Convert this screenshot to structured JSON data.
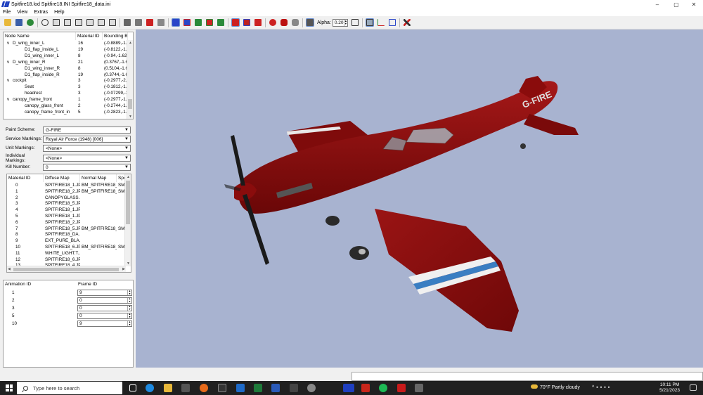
{
  "window": {
    "title": "Spitfire18.lod  Spitfire18.INI  Spitfire18_data.ini",
    "controls": [
      "–",
      "▢",
      "✕"
    ]
  },
  "menu": [
    "File",
    "View",
    "Extras",
    "Help"
  ],
  "toolbar": {
    "alpha_label": "Alpha:",
    "alpha_value": "0.20"
  },
  "node_tree": {
    "headers": [
      "Node Name",
      "Material ID",
      "Bounding Bo"
    ],
    "rows": [
      {
        "indent": 1,
        "expander": "v",
        "name": "D_wing_inner_L",
        "mat": "16",
        "bb": "(-0.8889,-1.6"
      },
      {
        "indent": 2,
        "expander": "",
        "name": "D1_flap_inside_L",
        "mat": "19",
        "bb": "(-0.8122,-1.6"
      },
      {
        "indent": 2,
        "expander": "",
        "name": "D1_wing_inner_L",
        "mat": "8",
        "bb": "(-0.94,-1.62,-"
      },
      {
        "indent": 1,
        "expander": "v",
        "name": "D_wing_inner_R",
        "mat": "21",
        "bb": "(0.3767,-1.62"
      },
      {
        "indent": 2,
        "expander": "",
        "name": "D1_wing_inner_R",
        "mat": "8",
        "bb": "(0.5104,-1.62"
      },
      {
        "indent": 2,
        "expander": "",
        "name": "D1_flap_inside_R",
        "mat": "19",
        "bb": "(0.3744,-1.62"
      },
      {
        "indent": 1,
        "expander": "v",
        "name": "cockpit",
        "mat": "3",
        "bb": "(-0.2977,-2.0"
      },
      {
        "indent": 2,
        "expander": "",
        "name": "Seat",
        "mat": "3",
        "bb": "(-0.1812,-1.6"
      },
      {
        "indent": 2,
        "expander": "",
        "name": "headrest",
        "mat": "3",
        "bb": "(-0.07299,-1."
      },
      {
        "indent": 1,
        "expander": "v",
        "name": "canopy_frame_front",
        "mat": "1",
        "bb": "(-0.2977,-1.1"
      },
      {
        "indent": 2,
        "expander": "",
        "name": "canopy_glass_front",
        "mat": "2",
        "bb": "(-0.2744,-1.0"
      },
      {
        "indent": 2,
        "expander": "",
        "name": "canopy_frame_front_in",
        "mat": "5",
        "bb": "(-0.2823,-1.1"
      }
    ]
  },
  "markings": {
    "paint_scheme": {
      "label": "Paint Scheme:",
      "value": "G-FIRE"
    },
    "service_markings": {
      "label": "Service Markings:",
      "value": "Royal Air Force (1948) [006]"
    },
    "unit_markings": {
      "label": "Unit Markings:",
      "value": "<None>"
    },
    "individual_markings": {
      "label": "Individual Markings:",
      "value": "<None>"
    },
    "kill_number": {
      "label": "Kill Number:",
      "value": "0"
    }
  },
  "materials": {
    "headers": [
      "Material ID",
      "Diffuse Map",
      "Normal Map",
      "Spe"
    ],
    "rows": [
      {
        "id": "0",
        "diffuse": "SPITFIRE18_1.JPG",
        "normal": "BM_SPITFIRE18_...",
        "spec": "SM"
      },
      {
        "id": "1",
        "diffuse": "SPITFIRE18_2.JPG",
        "normal": "BM_SPITFIRE18_...",
        "spec": "SM"
      },
      {
        "id": "2",
        "diffuse": "CANOPYGLASS....",
        "normal": "",
        "spec": ""
      },
      {
        "id": "3",
        "diffuse": "SPITFIRE18_5.JPG",
        "normal": "",
        "spec": ""
      },
      {
        "id": "4",
        "diffuse": "SPITFIRE18_1.JPG",
        "normal": "",
        "spec": ""
      },
      {
        "id": "5",
        "diffuse": "SPITFIRE18_1.JPG",
        "normal": "",
        "spec": ""
      },
      {
        "id": "6",
        "diffuse": "SPITFIRE18_2.JPG",
        "normal": "",
        "spec": ""
      },
      {
        "id": "7",
        "diffuse": "SPITFIRE18_5.JPG",
        "normal": "BM_SPITFIRE18_...",
        "spec": "SM"
      },
      {
        "id": "8",
        "diffuse": "SPITFIRE18_DA...",
        "normal": "",
        "spec": ""
      },
      {
        "id": "9",
        "diffuse": "EXT_PURE_BLA...",
        "normal": "",
        "spec": ""
      },
      {
        "id": "10",
        "diffuse": "SPITFIRE18_6.JPG",
        "normal": "BM_SPITFIRE18_...",
        "spec": "SM"
      },
      {
        "id": "11",
        "diffuse": "WHITE_LIGHT.T...",
        "normal": "",
        "spec": ""
      },
      {
        "id": "12",
        "diffuse": "SPITFIRE18_6.JPG",
        "normal": "",
        "spec": ""
      },
      {
        "id": "13",
        "diffuse": "SPITFIRE18_4.JPG",
        "normal": "",
        "spec": ""
      }
    ]
  },
  "animations": {
    "headers": [
      "Animation ID",
      "Frame ID"
    ],
    "rows": [
      {
        "id": "1",
        "frame": "9"
      },
      {
        "id": "2",
        "frame": "0"
      },
      {
        "id": "3",
        "frame": "0"
      },
      {
        "id": "5",
        "frame": "0"
      },
      {
        "id": "10",
        "frame": "9"
      }
    ]
  },
  "viewport": {
    "registration": "G-FIRE",
    "background": "#a8b3d0",
    "aircraft_color": "#8a0c0c"
  },
  "taskbar": {
    "search_placeholder": "Type here to search",
    "weather": "70°F  Partly cloudy",
    "time": "10:11 PM",
    "date": "5/21/2023"
  }
}
